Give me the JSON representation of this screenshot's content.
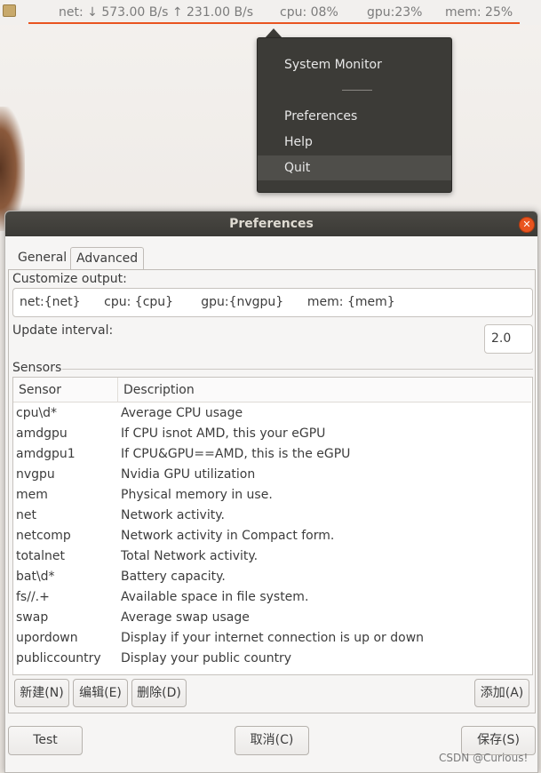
{
  "top_panel": {
    "net_label": "net: ↓ 573.00 B/s ↑ 231.00 B/s",
    "cpu_label": "cpu: 08%",
    "gpu_label": "gpu:23%",
    "mem_label": "mem: 25%",
    "accent_color": "#e95420"
  },
  "menu": {
    "title": "System Monitor",
    "items": [
      "Preferences",
      "Help",
      "Quit"
    ],
    "active_item": "Quit"
  },
  "window": {
    "title": "Preferences",
    "close_icon": "close-icon",
    "tabs": [
      {
        "label": "General",
        "active": false
      },
      {
        "label": "Advanced",
        "active": true
      }
    ],
    "customize_label": "Customize output:",
    "customize_value": "net:{net}      cpu: {cpu}       gpu:{nvgpu}      mem: {mem}",
    "update_interval_label": "Update interval:",
    "update_interval_value": "2.0",
    "sensors_label": "Sensors",
    "columns": [
      "Sensor",
      "Description"
    ],
    "rows": [
      [
        "cpu\\d*",
        "Average CPU usage"
      ],
      [
        "amdgpu",
        "If CPU isnot AMD, this your eGPU"
      ],
      [
        "amdgpu1",
        "If CPU&GPU==AMD, this is the eGPU"
      ],
      [
        "nvgpu",
        "Nvidia GPU utilization"
      ],
      [
        "mem",
        "Physical memory in use."
      ],
      [
        "net",
        "Network activity."
      ],
      [
        "netcomp",
        "Network activity in Compact form."
      ],
      [
        "totalnet",
        "Total Network activity."
      ],
      [
        "bat\\d*",
        "Battery capacity."
      ],
      [
        "fs//.+",
        "Available space in file system."
      ],
      [
        "swap",
        "Average swap usage"
      ],
      [
        "upordown",
        "Display if your internet connection is up or down"
      ],
      [
        "publiccountry",
        "Display your public country"
      ]
    ],
    "buttons": {
      "new": "新建(N)",
      "edit": "编辑(E)",
      "delete": "删除(D)",
      "add": "添加(A)",
      "test": "Test",
      "cancel": "取消(C)",
      "save": "保存(S)"
    }
  },
  "watermark": "CSDN @Curious!"
}
